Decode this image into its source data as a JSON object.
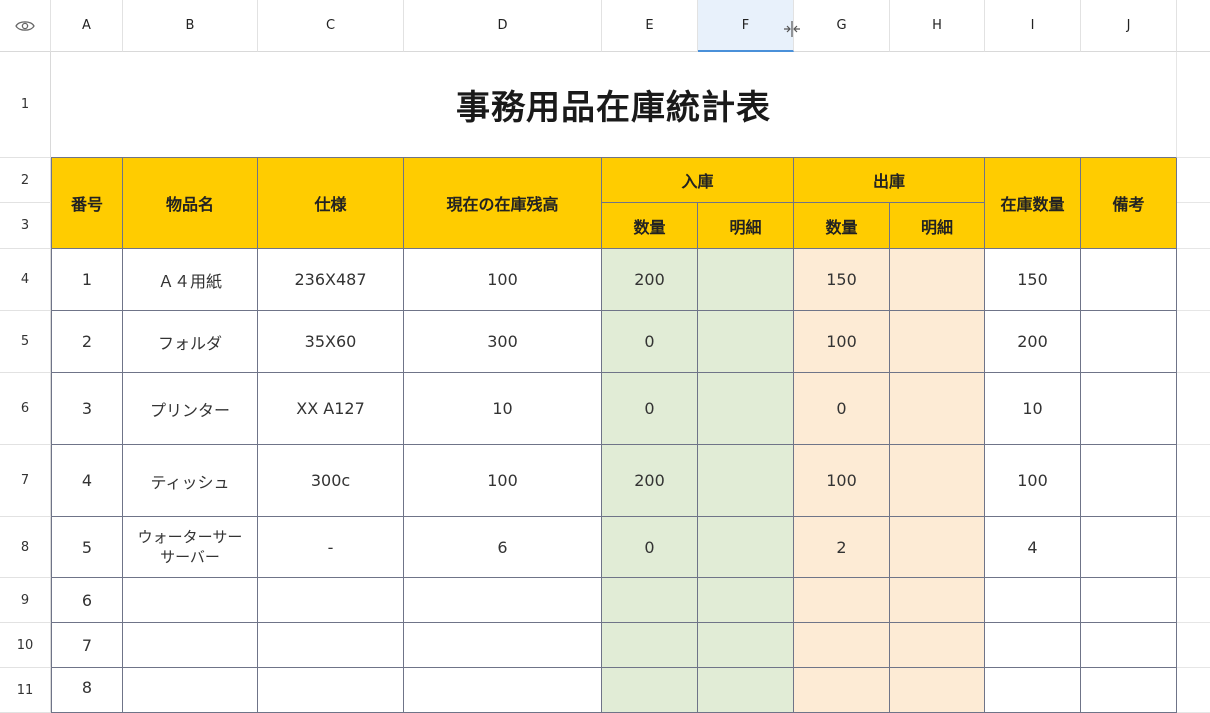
{
  "columns": [
    "A",
    "B",
    "C",
    "D",
    "E",
    "F",
    "G",
    "H",
    "I",
    "J"
  ],
  "rows": [
    "1",
    "2",
    "3",
    "4",
    "5",
    "6",
    "7",
    "8",
    "9",
    "10",
    "11"
  ],
  "title": "事務用品在庫統計表",
  "headers": {
    "no": "番号",
    "item": "物品名",
    "spec": "仕様",
    "current": "現在の在庫残高",
    "in": "入庫",
    "out": "出庫",
    "stock": "在庫数量",
    "note": "備考",
    "in_qty": "数量",
    "in_detail": "明細",
    "out_qty": "数量",
    "out_detail": "明細"
  },
  "table_rows": [
    {
      "no": "1",
      "item": "Ａ４用紙",
      "spec": "236X487",
      "current": "100",
      "in_qty": "200",
      "out_qty": "150",
      "stock": "150"
    },
    {
      "no": "2",
      "item": "フォルダ",
      "spec": "35X60",
      "current": "300",
      "in_qty": "0",
      "out_qty": "100",
      "stock": "200"
    },
    {
      "no": "3",
      "item": "プリンター",
      "spec": "XX A127",
      "current": "10",
      "in_qty": "0",
      "out_qty": "0",
      "stock": "10"
    },
    {
      "no": "4",
      "item": "ティッシュ",
      "spec": "300c",
      "current": "100",
      "in_qty": "200",
      "out_qty": "100",
      "stock": "100"
    },
    {
      "no": "5",
      "item": "ウォーターサーサーバー",
      "item_line1": "ウォーターサー",
      "item_line2": "サーバー",
      "spec": "-",
      "current": "6",
      "in_qty": "0",
      "out_qty": "2",
      "stock": "4"
    },
    {
      "no": "6"
    },
    {
      "no": "7"
    },
    {
      "no": "8"
    }
  ],
  "colors": {
    "header_fill": "#ffcc00",
    "in_fill": "#e1ecd6",
    "out_fill": "#fdebd5",
    "selected_col": "#e8f1fb"
  },
  "icons": {
    "corner": "eye-icon",
    "resize": "column-resize-icon"
  }
}
